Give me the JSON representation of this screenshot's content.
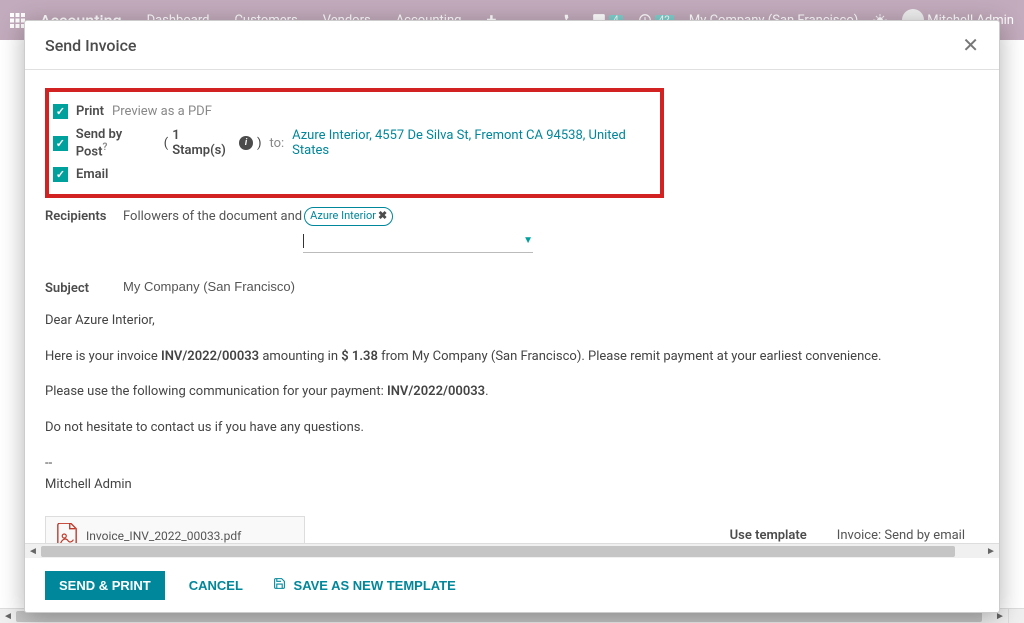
{
  "navbar": {
    "brand": "Accounting",
    "items": [
      "Dashboard",
      "Customers",
      "Vendors",
      "Accounting"
    ],
    "messages_badge": "4",
    "activities_badge": "42",
    "company": "My Company (San Francisco)",
    "user": "Mitchell Admin"
  },
  "modal": {
    "title": "Send Invoice",
    "options": {
      "print_label": "Print",
      "print_hint": "Preview as a PDF",
      "post_label": "Send by Post",
      "post_question": "?",
      "post_stamps_open": "(",
      "post_stamps_text": "1 Stamp(s)",
      "post_stamps_close": ")",
      "post_to_label": "to:",
      "post_address": "Azure Interior, 4557 De Silva St, Fremont CA 94538, United States",
      "email_label": "Email"
    },
    "recipients": {
      "label": "Recipients",
      "prefix": "Followers of the document and",
      "tag": "Azure Interior"
    },
    "subject": {
      "label": "Subject",
      "value": "My Company (San Francisco)"
    },
    "body": {
      "greeting": "Dear Azure Interior,",
      "line2_a": "Here is your invoice ",
      "line2_b": "INV/2022/00033",
      "line2_c": " amounting in ",
      "line2_d": "$ 1.38",
      "line2_e": " from My Company (San Francisco). Please remit payment at your earliest convenience.",
      "line3_a": "Please use the following communication for your payment: ",
      "line3_b": "INV/2022/00033",
      "line3_c": ".",
      "line4": "Do not hesitate to contact us if you have any questions.",
      "sig_dash": "--",
      "sig_name": "Mitchell Admin"
    },
    "attachment": "Invoice_INV_2022_00033.pdf",
    "template": {
      "label": "Use template",
      "value": "Invoice: Send by email"
    },
    "footer": {
      "send": "SEND & PRINT",
      "cancel": "CANCEL",
      "save_template": "SAVE AS NEW TEMPLATE"
    }
  }
}
